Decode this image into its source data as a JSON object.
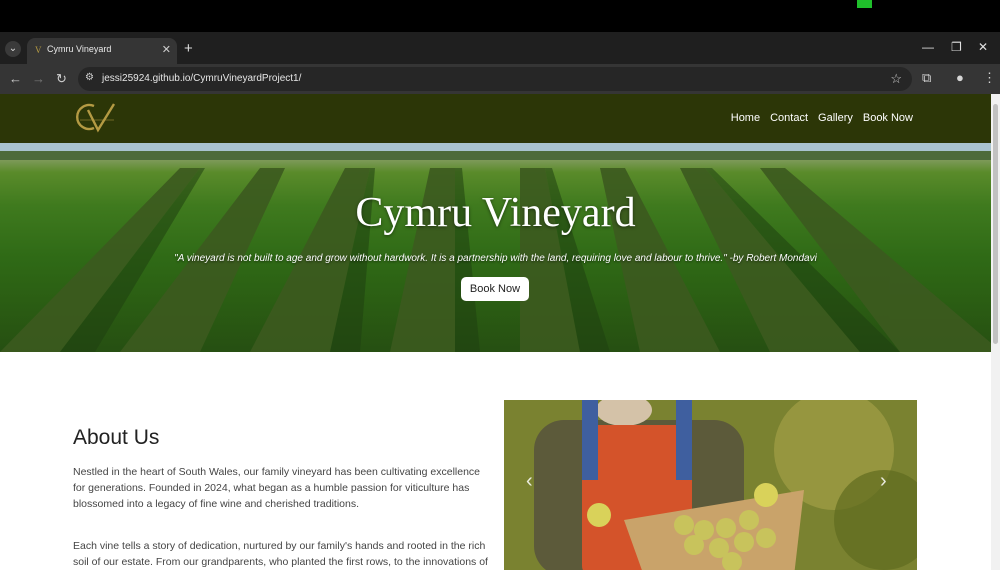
{
  "browser": {
    "tab_title": "Cymru Vineyard",
    "tab_close": "✕",
    "new_tab": "+",
    "url": "jessi25924.github.io/CymruVineyardProject1/"
  },
  "site": {
    "menu": [
      "Home",
      "Contact",
      "Gallery",
      "Book Now"
    ],
    "hero": {
      "title": "Cymru Vineyard",
      "quote": "\"A vineyard is not built to age and grow without hardwork. It is a partnership with the land, requiring love and labour to thrive.\" -by Robert Mondavi",
      "button": "Book Now"
    },
    "about": {
      "title": "About Us",
      "p1": "Nestled in the heart of South Wales, our family vineyard has been cultivating excellence for generations. Founded in 2024, what began as a humble passion for viticulture has blossomed into a legacy of fine wine and cherished traditions.",
      "p2": "Each vine tells a story of dedication, nurtured by our family's hands and rooted in the rich soil of our estate. From our grandparents, who planted the first rows, to the innovations of"
    }
  },
  "icons": {
    "tab_dropdown": "chevron-down-icon",
    "back": "back-arrow-icon",
    "forward": "forward-arrow-icon",
    "reload": "reload-icon",
    "site_info": "site-info-icon",
    "bookmark": "star-icon",
    "extensions": "puzzle-icon",
    "profile": "profile-icon",
    "menu": "kebab-menu-icon",
    "carousel_prev": "chevron-left-icon",
    "carousel_next": "chevron-right-icon"
  },
  "colors": {
    "site_nav_bg": "#2c3607",
    "logo_gold": "#b49a43"
  }
}
